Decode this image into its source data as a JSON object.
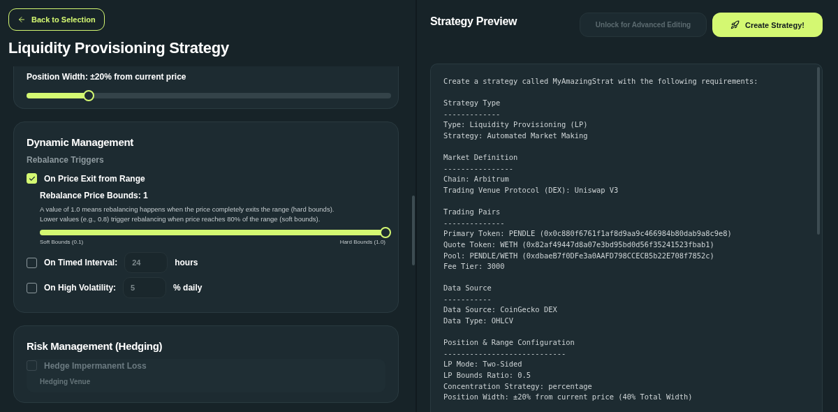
{
  "back_button": {
    "label": "Back to Selection"
  },
  "title": "Liquidity Provisioning Strategy",
  "position_card": {
    "label": "Position Width: ±20% from current price",
    "level": 0.17
  },
  "dynamic_card": {
    "title": "Dynamic Management",
    "subtitle": "Rebalance Triggers",
    "triggers": [
      {
        "kind": "bounds",
        "label": "On Price Exit from Range",
        "checked": true,
        "bounds_label": "Rebalance Price Bounds: 1",
        "help": [
          "A value of 1.0 means rebalancing happens when the price completely exits the range (hard bounds).",
          "Lower values (e.g., 0.8) trigger rebalancing when price reaches 80% of the range (soft bounds)."
        ],
        "level": 1,
        "min_label": "Soft Bounds (0.1)",
        "max_label": "Hard Bounds (1.0)"
      },
      {
        "kind": "input",
        "label": "On Timed Interval:",
        "checked": false,
        "placeholder": "24",
        "unit": "hours"
      },
      {
        "kind": "input",
        "label": "On High Volatility:",
        "checked": false,
        "placeholder": "5",
        "unit": "% daily"
      }
    ]
  },
  "risk_card": {
    "title": "Risk Management (Hedging)",
    "hedge": {
      "label": "Hedge Impermanent Loss",
      "checked": false,
      "disabled": true
    },
    "venue_label": "Hedging Venue"
  },
  "preview": {
    "title": "Strategy Preview",
    "unlock_button": {
      "label": "Unlock for Advanced Editing",
      "disabled": true
    },
    "create_button": {
      "label": "Create Strategy!"
    },
    "intro": "Create a strategy called MyAmazingStrat with the following requirements:",
    "sections": [
      {
        "heading": "Strategy Type",
        "rule": "-------------",
        "lines": [
          "Type: Liquidity Provisioning (LP)",
          "Strategy: Automated Market Making"
        ]
      },
      {
        "heading": "Market Definition",
        "rule": "----------------",
        "lines": [
          "Chain: Arbitrum",
          "Trading Venue Protocol (DEX): Uniswap V3"
        ]
      },
      {
        "heading": "Trading Pairs",
        "rule": "--------------",
        "lines": [
          "Primary Token: PENDLE (0x0c880f6761f1af8d9aa9c466984b80dab9a8c9e8)",
          "Quote Token: WETH (0x82af49447d8a07e3bd95bd0d56f35241523fbab1)",
          "Pool: PENDLE/WETH (0xdbaeB7f0DFe3a0AAFD798CCECB5b22E708f7852c)",
          "Fee Tier: 3000"
        ]
      },
      {
        "heading": "Data Source",
        "rule": "-----------",
        "lines": [
          "Data Source: CoinGecko DEX",
          "Data Type: OHLCV"
        ]
      },
      {
        "heading": "Position & Range Configuration",
        "rule": "----------------------------",
        "lines": [
          "LP Mode: Two-Sided",
          "LP Bounds Ratio: 0.5",
          "Concentration Strategy: percentage",
          "Position Width: ±20% from current price (40% Total Width)"
        ]
      }
    ]
  }
}
